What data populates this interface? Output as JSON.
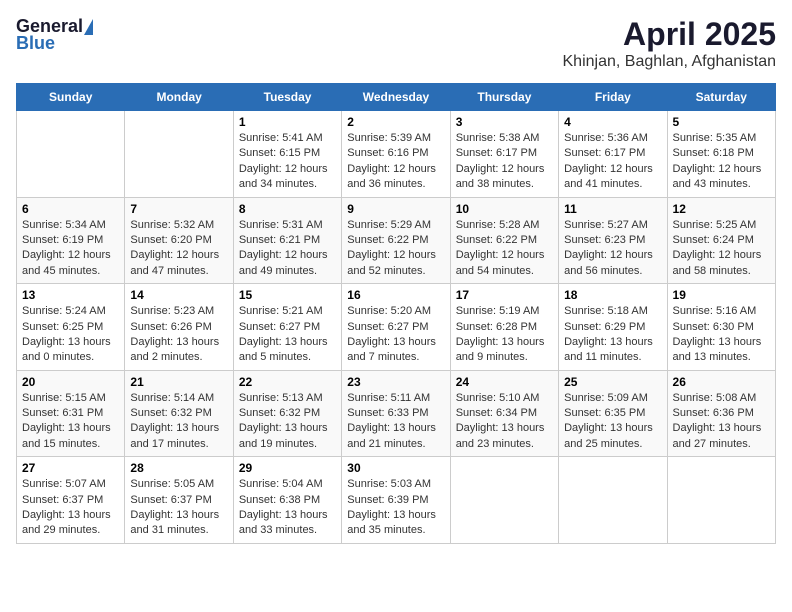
{
  "header": {
    "logo_general": "General",
    "logo_blue": "Blue",
    "title": "April 2025",
    "subtitle": "Khinjan, Baghlan, Afghanistan"
  },
  "weekdays": [
    "Sunday",
    "Monday",
    "Tuesday",
    "Wednesday",
    "Thursday",
    "Friday",
    "Saturday"
  ],
  "weeks": [
    [
      {
        "day": null
      },
      {
        "day": null
      },
      {
        "day": "1",
        "sunrise": "Sunrise: 5:41 AM",
        "sunset": "Sunset: 6:15 PM",
        "daylight": "Daylight: 12 hours and 34 minutes."
      },
      {
        "day": "2",
        "sunrise": "Sunrise: 5:39 AM",
        "sunset": "Sunset: 6:16 PM",
        "daylight": "Daylight: 12 hours and 36 minutes."
      },
      {
        "day": "3",
        "sunrise": "Sunrise: 5:38 AM",
        "sunset": "Sunset: 6:17 PM",
        "daylight": "Daylight: 12 hours and 38 minutes."
      },
      {
        "day": "4",
        "sunrise": "Sunrise: 5:36 AM",
        "sunset": "Sunset: 6:17 PM",
        "daylight": "Daylight: 12 hours and 41 minutes."
      },
      {
        "day": "5",
        "sunrise": "Sunrise: 5:35 AM",
        "sunset": "Sunset: 6:18 PM",
        "daylight": "Daylight: 12 hours and 43 minutes."
      }
    ],
    [
      {
        "day": "6",
        "sunrise": "Sunrise: 5:34 AM",
        "sunset": "Sunset: 6:19 PM",
        "daylight": "Daylight: 12 hours and 45 minutes."
      },
      {
        "day": "7",
        "sunrise": "Sunrise: 5:32 AM",
        "sunset": "Sunset: 6:20 PM",
        "daylight": "Daylight: 12 hours and 47 minutes."
      },
      {
        "day": "8",
        "sunrise": "Sunrise: 5:31 AM",
        "sunset": "Sunset: 6:21 PM",
        "daylight": "Daylight: 12 hours and 49 minutes."
      },
      {
        "day": "9",
        "sunrise": "Sunrise: 5:29 AM",
        "sunset": "Sunset: 6:22 PM",
        "daylight": "Daylight: 12 hours and 52 minutes."
      },
      {
        "day": "10",
        "sunrise": "Sunrise: 5:28 AM",
        "sunset": "Sunset: 6:22 PM",
        "daylight": "Daylight: 12 hours and 54 minutes."
      },
      {
        "day": "11",
        "sunrise": "Sunrise: 5:27 AM",
        "sunset": "Sunset: 6:23 PM",
        "daylight": "Daylight: 12 hours and 56 minutes."
      },
      {
        "day": "12",
        "sunrise": "Sunrise: 5:25 AM",
        "sunset": "Sunset: 6:24 PM",
        "daylight": "Daylight: 12 hours and 58 minutes."
      }
    ],
    [
      {
        "day": "13",
        "sunrise": "Sunrise: 5:24 AM",
        "sunset": "Sunset: 6:25 PM",
        "daylight": "Daylight: 13 hours and 0 minutes."
      },
      {
        "day": "14",
        "sunrise": "Sunrise: 5:23 AM",
        "sunset": "Sunset: 6:26 PM",
        "daylight": "Daylight: 13 hours and 2 minutes."
      },
      {
        "day": "15",
        "sunrise": "Sunrise: 5:21 AM",
        "sunset": "Sunset: 6:27 PM",
        "daylight": "Daylight: 13 hours and 5 minutes."
      },
      {
        "day": "16",
        "sunrise": "Sunrise: 5:20 AM",
        "sunset": "Sunset: 6:27 PM",
        "daylight": "Daylight: 13 hours and 7 minutes."
      },
      {
        "day": "17",
        "sunrise": "Sunrise: 5:19 AM",
        "sunset": "Sunset: 6:28 PM",
        "daylight": "Daylight: 13 hours and 9 minutes."
      },
      {
        "day": "18",
        "sunrise": "Sunrise: 5:18 AM",
        "sunset": "Sunset: 6:29 PM",
        "daylight": "Daylight: 13 hours and 11 minutes."
      },
      {
        "day": "19",
        "sunrise": "Sunrise: 5:16 AM",
        "sunset": "Sunset: 6:30 PM",
        "daylight": "Daylight: 13 hours and 13 minutes."
      }
    ],
    [
      {
        "day": "20",
        "sunrise": "Sunrise: 5:15 AM",
        "sunset": "Sunset: 6:31 PM",
        "daylight": "Daylight: 13 hours and 15 minutes."
      },
      {
        "day": "21",
        "sunrise": "Sunrise: 5:14 AM",
        "sunset": "Sunset: 6:32 PM",
        "daylight": "Daylight: 13 hours and 17 minutes."
      },
      {
        "day": "22",
        "sunrise": "Sunrise: 5:13 AM",
        "sunset": "Sunset: 6:32 PM",
        "daylight": "Daylight: 13 hours and 19 minutes."
      },
      {
        "day": "23",
        "sunrise": "Sunrise: 5:11 AM",
        "sunset": "Sunset: 6:33 PM",
        "daylight": "Daylight: 13 hours and 21 minutes."
      },
      {
        "day": "24",
        "sunrise": "Sunrise: 5:10 AM",
        "sunset": "Sunset: 6:34 PM",
        "daylight": "Daylight: 13 hours and 23 minutes."
      },
      {
        "day": "25",
        "sunrise": "Sunrise: 5:09 AM",
        "sunset": "Sunset: 6:35 PM",
        "daylight": "Daylight: 13 hours and 25 minutes."
      },
      {
        "day": "26",
        "sunrise": "Sunrise: 5:08 AM",
        "sunset": "Sunset: 6:36 PM",
        "daylight": "Daylight: 13 hours and 27 minutes."
      }
    ],
    [
      {
        "day": "27",
        "sunrise": "Sunrise: 5:07 AM",
        "sunset": "Sunset: 6:37 PM",
        "daylight": "Daylight: 13 hours and 29 minutes."
      },
      {
        "day": "28",
        "sunrise": "Sunrise: 5:05 AM",
        "sunset": "Sunset: 6:37 PM",
        "daylight": "Daylight: 13 hours and 31 minutes."
      },
      {
        "day": "29",
        "sunrise": "Sunrise: 5:04 AM",
        "sunset": "Sunset: 6:38 PM",
        "daylight": "Daylight: 13 hours and 33 minutes."
      },
      {
        "day": "30",
        "sunrise": "Sunrise: 5:03 AM",
        "sunset": "Sunset: 6:39 PM",
        "daylight": "Daylight: 13 hours and 35 minutes."
      },
      {
        "day": null
      },
      {
        "day": null
      },
      {
        "day": null
      }
    ]
  ]
}
